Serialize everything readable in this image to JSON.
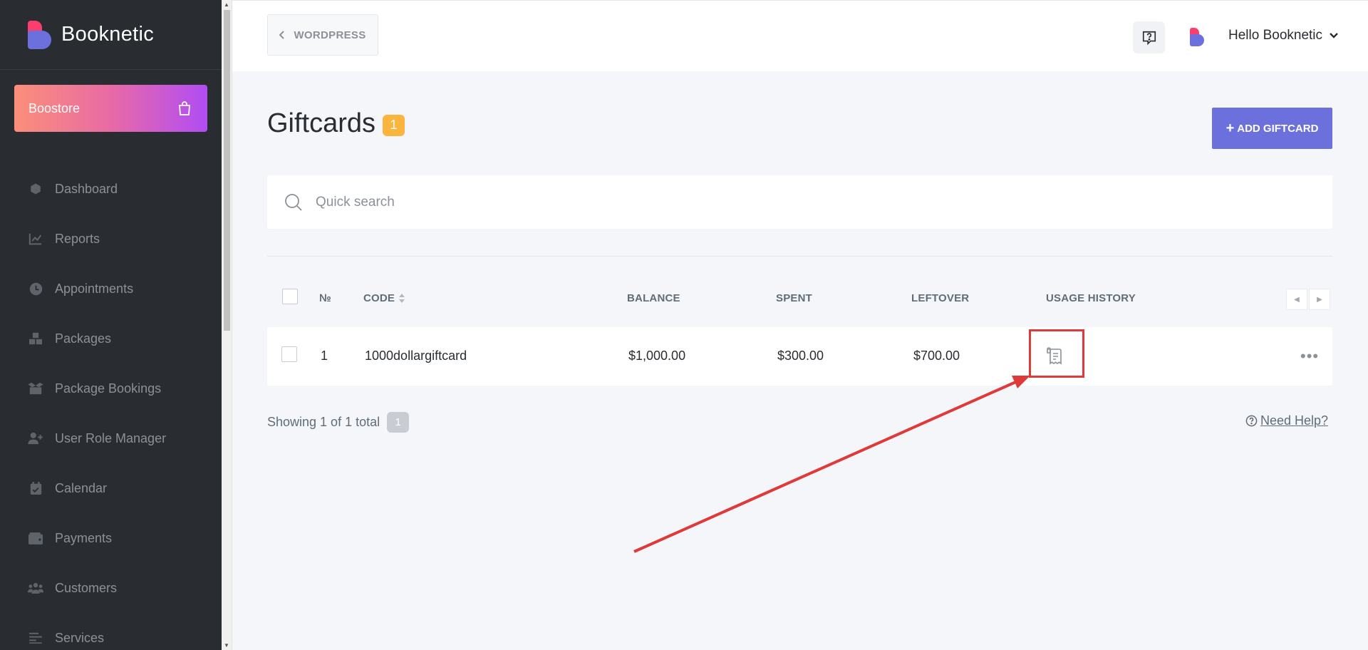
{
  "app": {
    "brand_name": "Booknetic"
  },
  "sidebar": {
    "boostore_label": "Boostore",
    "items": [
      {
        "label": "Dashboard",
        "icon": "cube-icon"
      },
      {
        "label": "Reports",
        "icon": "chart-line-icon"
      },
      {
        "label": "Appointments",
        "icon": "clock-icon"
      },
      {
        "label": "Packages",
        "icon": "boxes-icon"
      },
      {
        "label": "Package Bookings",
        "icon": "box-open-icon"
      },
      {
        "label": "User Role Manager",
        "icon": "user-plus-icon"
      },
      {
        "label": "Calendar",
        "icon": "calendar-check-icon"
      },
      {
        "label": "Payments",
        "icon": "wallet-icon"
      },
      {
        "label": "Customers",
        "icon": "users-icon"
      },
      {
        "label": "Services",
        "icon": "list-icon"
      }
    ]
  },
  "topbar": {
    "back_label": "WORDPRESS",
    "greeting": "Hello Booknetic"
  },
  "page": {
    "title": "Giftcards",
    "count": "1",
    "add_button_label": "ADD GIFTCARD"
  },
  "search": {
    "placeholder": "Quick search"
  },
  "table": {
    "columns": {
      "num": "№",
      "code": "CODE",
      "balance": "BALANCE",
      "spent": "SPENT",
      "leftover": "LEFTOVER",
      "usage_history": "USAGE HISTORY"
    },
    "rows": [
      {
        "num": "1",
        "code": "1000dollargiftcard",
        "balance": "$1,000.00",
        "spent": "$300.00",
        "leftover": "$700.00"
      }
    ]
  },
  "footer": {
    "showing": "Showing 1 of 1 total",
    "page": "1",
    "need_help": "Need Help?"
  },
  "colors": {
    "accent": "#6c70dc",
    "brand_pink": "#fb3e6e",
    "badge_yellow": "#fbb43d",
    "sidebar_bg": "#292d32",
    "highlight_red": "#df3a3a"
  }
}
